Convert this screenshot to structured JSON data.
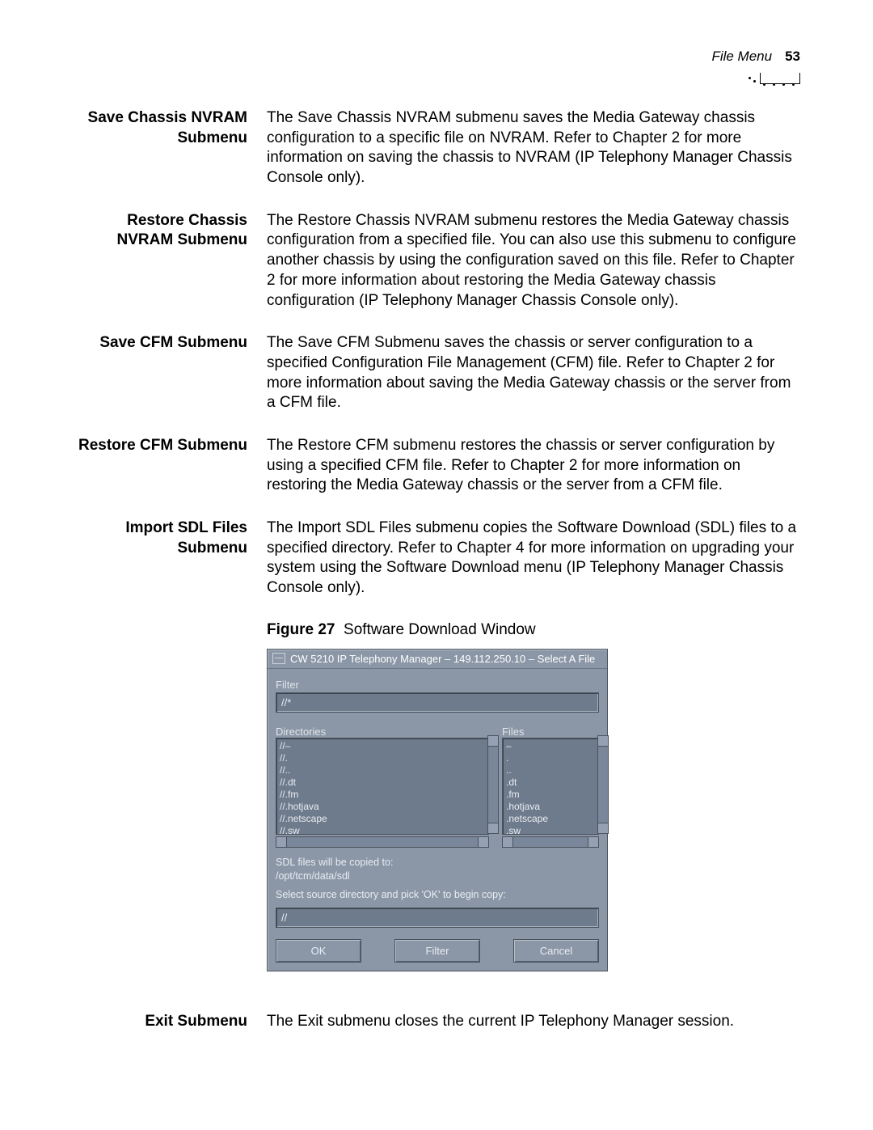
{
  "header": {
    "section": "File Menu",
    "page": "53"
  },
  "sections": [
    {
      "label": "Save Chassis NVRAM Submenu",
      "body": "The Save Chassis NVRAM submenu saves the Media Gateway chassis configuration to a specific file on NVRAM. Refer to Chapter 2 for more information on saving the chassis to NVRAM (IP Telephony Manager Chassis Console only)."
    },
    {
      "label": "Restore Chassis NVRAM Submenu",
      "body": "The Restore Chassis NVRAM submenu restores the Media Gateway chassis configuration from a specified file. You can also use this submenu to configure another chassis by using the configuration saved on this file. Refer to Chapter 2 for more information about restoring the Media Gateway chassis configuration (IP Telephony Manager Chassis Console only)."
    },
    {
      "label": "Save CFM Submenu",
      "body": "The Save CFM Submenu saves the chassis or server configuration to a specified Configuration File Management (CFM) file. Refer to Chapter 2 for more information about saving the Media Gateway chassis or the server from a CFM file."
    },
    {
      "label": "Restore CFM Submenu",
      "body": "The Restore CFM submenu restores the chassis or server configuration by using a specified CFM file. Refer to Chapter 2 for more information on restoring the Media Gateway chassis or the server from a CFM file."
    },
    {
      "label": "Import SDL Files Submenu",
      "body": "The Import SDL Files submenu copies the Software Download (SDL) files to a specified directory. Refer to Chapter 4 for more information on upgrading your system using the Software Download menu (IP Telephony Manager Chassis Console only)."
    }
  ],
  "figure": {
    "label": "Figure 27",
    "caption": "Software Download Window"
  },
  "window": {
    "title": "CW 5210 IP Telephony Manager – 149.112.250.10 – Select A File",
    "filter_label": "Filter",
    "filter_value": "//*",
    "directories_label": "Directories",
    "directories": [
      "//–",
      "//.",
      "//..",
      "//.dt",
      "//.fm",
      "//.hotjava",
      "//.netscape",
      "//.sw"
    ],
    "files_label": "Files",
    "files": [
      "–",
      ".",
      "..",
      ".dt",
      ".fm",
      ".hotjava",
      ".netscape",
      ".sw"
    ],
    "note1": "SDL files will be copied to:",
    "note2": "/opt/tcm/data/sdl",
    "note3": "Select source directory and pick 'OK' to begin copy:",
    "path_value": "//",
    "buttons": {
      "ok": "OK",
      "filter": "Filter",
      "cancel": "Cancel"
    }
  },
  "exit": {
    "label": "Exit Submenu",
    "body": "The Exit submenu closes the current IP Telephony Manager session."
  }
}
